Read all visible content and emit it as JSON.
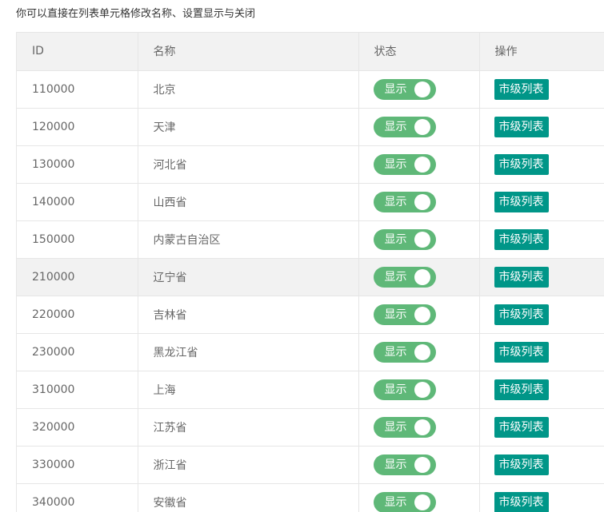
{
  "hint_text": "你可以直接在列表单元格修改名称、设置显示与关闭",
  "colors": {
    "switch_on": "#5fb878",
    "button": "#009688",
    "header_bg": "#f2f2f2",
    "border": "#e6e6e6"
  },
  "table": {
    "headers": {
      "id": "ID",
      "name": "名称",
      "status": "状态",
      "action": "操作"
    },
    "rows": [
      {
        "id": "110000",
        "name": "北京",
        "status": "显示",
        "action": "市级列表"
      },
      {
        "id": "120000",
        "name": "天津",
        "status": "显示",
        "action": "市级列表"
      },
      {
        "id": "130000",
        "name": "河北省",
        "status": "显示",
        "action": "市级列表"
      },
      {
        "id": "140000",
        "name": "山西省",
        "status": "显示",
        "action": "市级列表"
      },
      {
        "id": "150000",
        "name": "内蒙古自治区",
        "status": "显示",
        "action": "市级列表"
      },
      {
        "id": "210000",
        "name": "辽宁省",
        "status": "显示",
        "action": "市级列表"
      },
      {
        "id": "220000",
        "name": "吉林省",
        "status": "显示",
        "action": "市级列表"
      },
      {
        "id": "230000",
        "name": "黑龙江省",
        "status": "显示",
        "action": "市级列表"
      },
      {
        "id": "310000",
        "name": "上海",
        "status": "显示",
        "action": "市级列表"
      },
      {
        "id": "320000",
        "name": "江苏省",
        "status": "显示",
        "action": "市级列表"
      },
      {
        "id": "330000",
        "name": "浙江省",
        "status": "显示",
        "action": "市级列表"
      },
      {
        "id": "340000",
        "name": "安徽省",
        "status": "显示",
        "action": "市级列表"
      }
    ]
  }
}
